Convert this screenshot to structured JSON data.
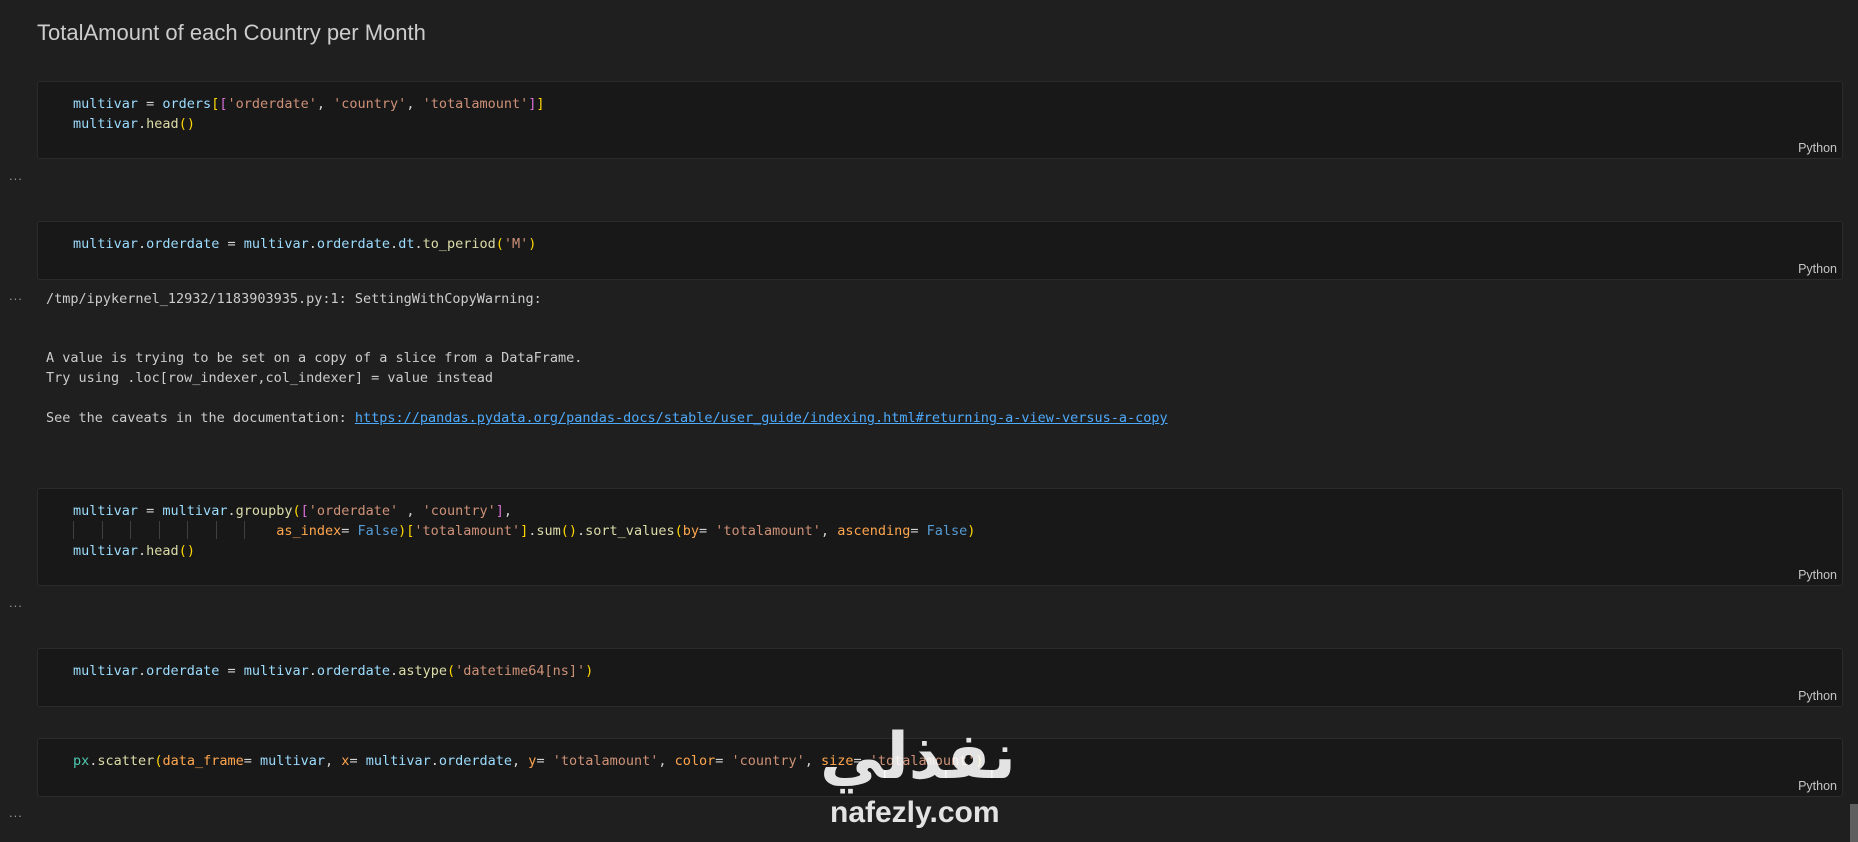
{
  "heading": "TotalAmount of each Country per Month",
  "cells": [
    {
      "language": "Python"
    },
    {
      "language": "Python"
    },
    {
      "language": "Python"
    },
    {
      "language": "Python"
    },
    {
      "language": "Python"
    }
  ],
  "output_collapsed_label": "...",
  "output": {
    "line1": "/tmp/ipykernel_12932/1183903935.py:1: SettingWithCopyWarning:",
    "line2": "A value is trying to be set on a copy of a slice from a DataFrame.",
    "line3": "Try using .loc[row_indexer,col_indexer] = value instead",
    "line4_prefix": "See the caveats in the documentation: ",
    "link": "https://pandas.pydata.org/pandas-docs/stable/user_guide/indexing.html#returning-a-view-versus-a-copy"
  },
  "watermark": {
    "arabic": "نفذلي",
    "latin": "nafezly.com"
  }
}
